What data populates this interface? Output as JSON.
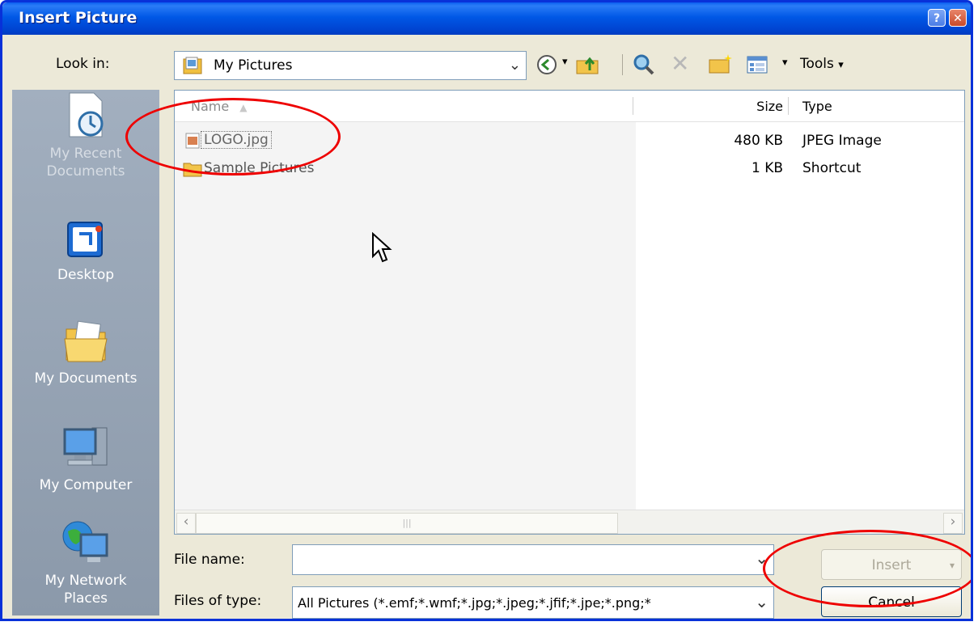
{
  "window": {
    "title": "Insert Picture",
    "help_glyph": "?",
    "close_glyph": "✕"
  },
  "lookin": {
    "label": "Look in:",
    "value": "My Pictures",
    "chevron": "⌄"
  },
  "toolbar": {
    "tools_label": "Tools",
    "dropdown_glyph": "▾",
    "delete_glyph": "✕"
  },
  "places": [
    {
      "label_line1": "My Recent",
      "label_line2": "Documents"
    },
    {
      "label_line1": "Desktop",
      "label_line2": ""
    },
    {
      "label_line1": "My Documents",
      "label_line2": ""
    },
    {
      "label_line1": "My Computer",
      "label_line2": ""
    },
    {
      "label_line1": "My Network",
      "label_line2": "Places"
    }
  ],
  "columns": {
    "name": "Name",
    "size": "Size",
    "type": "Type",
    "sort_glyph": "▲"
  },
  "files": [
    {
      "name": "LOGO.jpg",
      "size": "480 KB",
      "type": "JPEG Image"
    },
    {
      "name": "Sample Pictures",
      "size": "1 KB",
      "type": "Shortcut"
    }
  ],
  "scrollbar": {
    "left_glyph": "‹",
    "thumb_glyph": "|||",
    "right_glyph": "›"
  },
  "filename": {
    "label": "File name:",
    "value": "",
    "chevron": "⌄"
  },
  "filetype": {
    "label": "Files of type:",
    "value": "All Pictures (*.emf;*.wmf;*.jpg;*.jpeg;*.jfif;*.jpe;*.png;*",
    "chevron": "⌄"
  },
  "buttons": {
    "insert": "Insert",
    "insert_arrow": "▾",
    "cancel": "Cancel"
  },
  "colors": {
    "title_bar": "#0058e6",
    "dialog_bg": "#ece9d8",
    "places_bar": "#8b99aa",
    "annotation": "#e00000"
  }
}
